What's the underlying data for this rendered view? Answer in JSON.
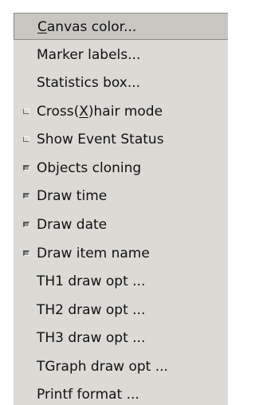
{
  "menu": {
    "items": [
      {
        "pre": "",
        "mnemonic": "C",
        "post": "anvas color...",
        "check": "none"
      },
      {
        "pre": "Marker labels...",
        "mnemonic": "",
        "post": "",
        "check": "none"
      },
      {
        "pre": "Statistics box...",
        "mnemonic": "",
        "post": "",
        "check": "none"
      },
      {
        "pre": "Cross(",
        "mnemonic": "X",
        "post": ")hair mode",
        "check": "off"
      },
      {
        "pre": "Show Event Status",
        "mnemonic": "",
        "post": "",
        "check": "off"
      },
      {
        "pre": "Objects cloning",
        "mnemonic": "",
        "post": "",
        "check": "on"
      },
      {
        "pre": "Draw time",
        "mnemonic": "",
        "post": "",
        "check": "on"
      },
      {
        "pre": "Draw date",
        "mnemonic": "",
        "post": "",
        "check": "on"
      },
      {
        "pre": "Draw item name",
        "mnemonic": "",
        "post": "",
        "check": "on"
      },
      {
        "pre": "TH1 draw opt ...",
        "mnemonic": "",
        "post": "",
        "check": "none"
      },
      {
        "pre": "TH2 draw opt ...",
        "mnemonic": "",
        "post": "",
        "check": "none"
      },
      {
        "pre": "TH3 draw opt ...",
        "mnemonic": "",
        "post": "",
        "check": "none"
      },
      {
        "pre": "TGraph draw opt ...",
        "mnemonic": "",
        "post": "",
        "check": "none"
      },
      {
        "pre": "Printf format ...",
        "mnemonic": "",
        "post": "",
        "check": "none"
      }
    ]
  }
}
